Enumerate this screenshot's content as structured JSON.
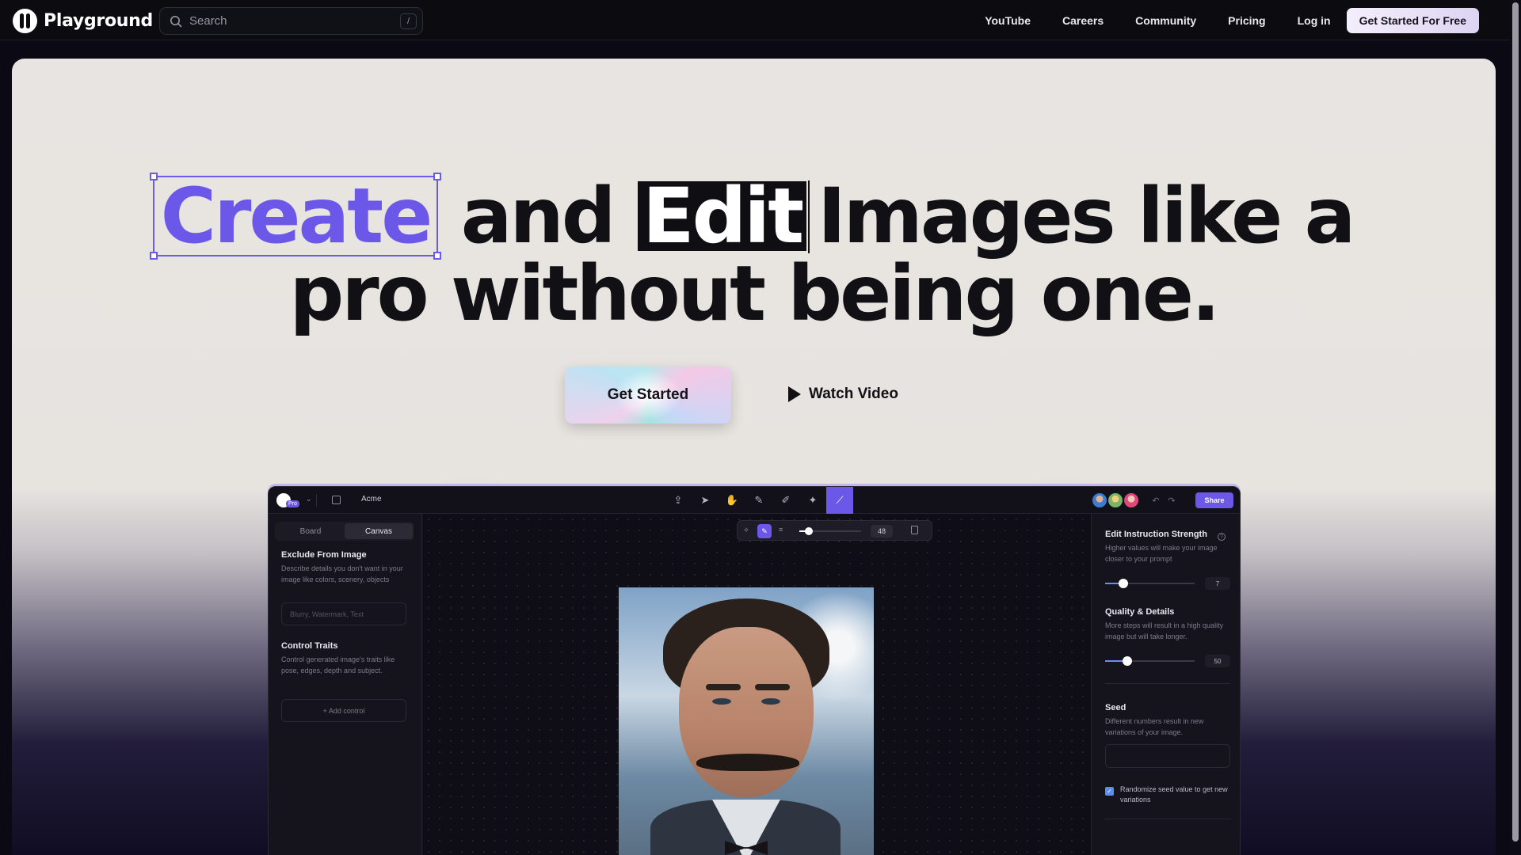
{
  "nav": {
    "brand": "Playground",
    "search_placeholder": "Search",
    "search_shortcut": "/",
    "links": [
      "YouTube",
      "Careers",
      "Community",
      "Pricing",
      "Log in"
    ],
    "cta": "Get Started For Free"
  },
  "hero": {
    "headline_word_create": "Create",
    "headline_word_and": "and",
    "headline_word_edit": "Edit",
    "headline_rest_line1": "Images like a",
    "headline_line2": "pro without being one.",
    "primary_button": "Get Started",
    "secondary_button": "Watch Video"
  },
  "app": {
    "badge": "Pro",
    "workspace": "Acme",
    "share": "Share",
    "tabs": [
      "Board",
      "Canvas"
    ],
    "active_tab": "Canvas",
    "brush_size": "48",
    "brush_size_level": 0.15,
    "left": {
      "exclude_title": "Exclude From Image",
      "exclude_desc": "Describe details you don't want in your image like colors, scenery, objects",
      "exclude_placeholder": "Blurry, Watermark, Text",
      "control_title": "Control Traits",
      "control_desc": "Control generated image's traits like pose, edges, depth and subject.",
      "add_control": "+ Add control"
    },
    "right": {
      "strength_title": "Edit Instruction Strength",
      "strength_desc": "Higher values will make your image closer to your prompt",
      "strength_value": "7",
      "strength_level": 0.2,
      "quality_title": "Quality & Details",
      "quality_desc": "More steps will result in a high quality image but will take longer.",
      "quality_value": "50",
      "quality_level": 0.25,
      "seed_title": "Seed",
      "seed_desc": "Different numbers result in new variations of your image.",
      "randomize_label": "Randomize seed value to get new variations",
      "randomize_checked": true
    },
    "colors": {
      "accent": "#6b57e8"
    }
  }
}
